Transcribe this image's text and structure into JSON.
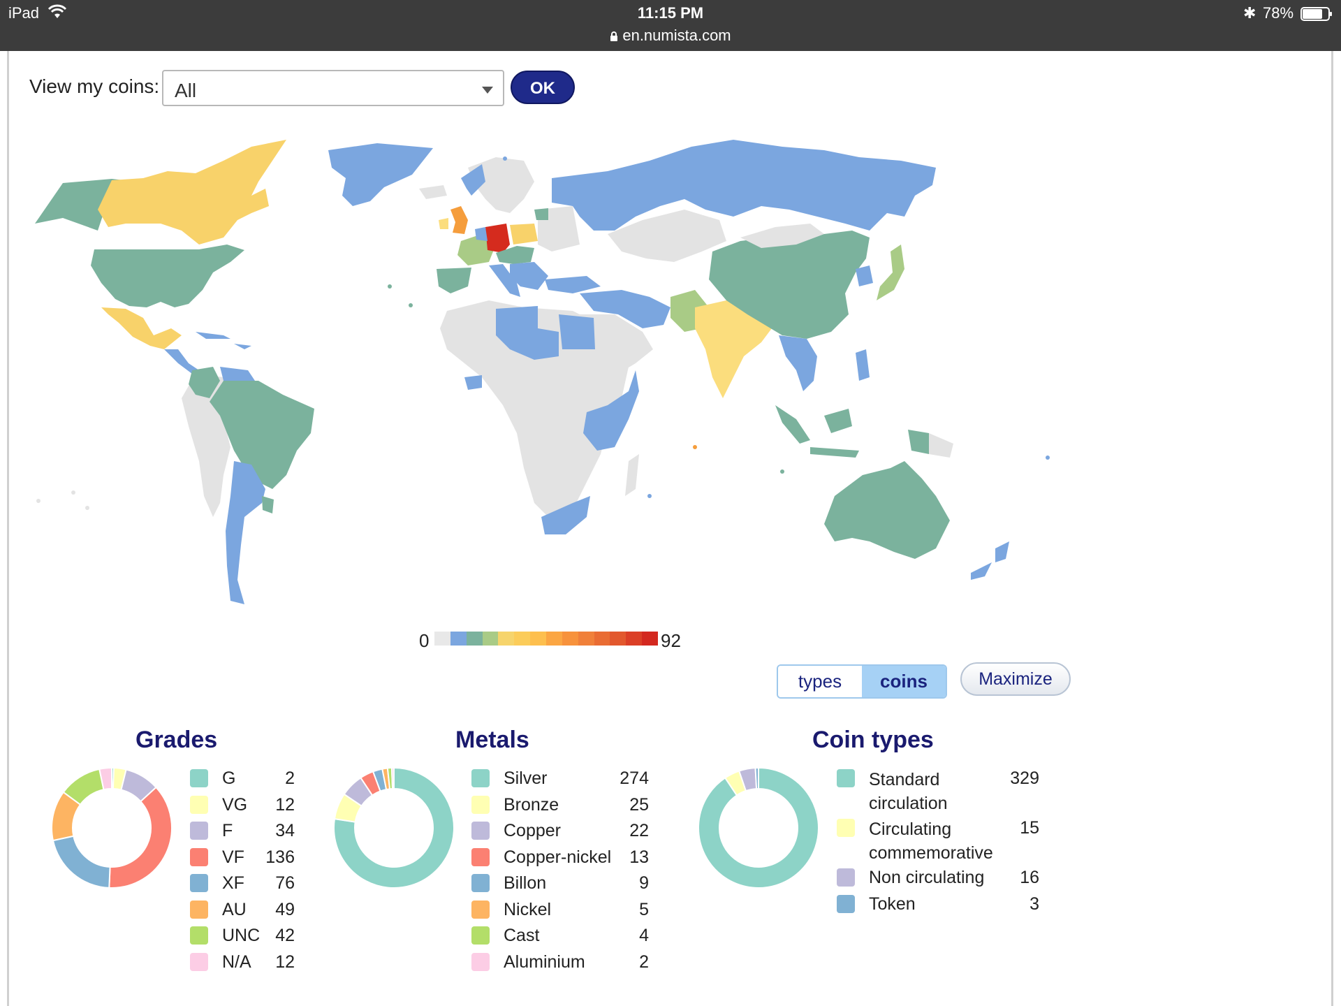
{
  "status_bar": {
    "device": "iPad",
    "time": "11:15 PM",
    "url": "en.numista.com",
    "bluetooth": "✱",
    "battery": "78%",
    "battery_level": 0.78
  },
  "filter": {
    "label": "View my coins:",
    "selected": "All",
    "ok_label": "OK"
  },
  "map": {
    "scale_min": "0",
    "scale_max": "92",
    "scale_colors": [
      "#e8e8e8",
      "#7ba6df",
      "#7bb29d",
      "#a9cb86",
      "#f6d46c",
      "#fbcc5a",
      "#fdbf4e",
      "#fba643",
      "#f7923c",
      "#f0803a",
      "#e96c33",
      "#e2582d",
      "#db3f26",
      "#d3281f"
    ],
    "colors": {
      "none": "#e3e3e3",
      "blue": "#7ba6df",
      "teal": "#7bb29d",
      "lightgreen": "#a9cb86",
      "yellow": "#f8d26a",
      "lightyellow": "#fbdd7d",
      "orange": "#f59d3c",
      "red": "#d52b1e"
    }
  },
  "toggle": {
    "types_label": "types",
    "coins_label": "coins",
    "maximize_label": "Maximize"
  },
  "grades": {
    "title": "Grades",
    "items": [
      {
        "label": "G",
        "value": 2,
        "color": "#8dd3c7"
      },
      {
        "label": "VG",
        "value": 12,
        "color": "#ffffb3"
      },
      {
        "label": "F",
        "value": 34,
        "color": "#bebada"
      },
      {
        "label": "VF",
        "value": 136,
        "color": "#fb8072"
      },
      {
        "label": "XF",
        "value": 76,
        "color": "#80b1d3"
      },
      {
        "label": "AU",
        "value": 49,
        "color": "#fdb462"
      },
      {
        "label": "UNC",
        "value": 42,
        "color": "#b3de69"
      },
      {
        "label": "N/A",
        "value": 12,
        "color": "#fccde5"
      }
    ]
  },
  "metals": {
    "title": "Metals",
    "items": [
      {
        "label": "Silver",
        "value": 274,
        "color": "#8dd3c7"
      },
      {
        "label": "Bronze",
        "value": 25,
        "color": "#ffffb3"
      },
      {
        "label": "Copper",
        "value": 22,
        "color": "#bebada"
      },
      {
        "label": "Copper-nickel",
        "value": 13,
        "color": "#fb8072"
      },
      {
        "label": "Billon",
        "value": 9,
        "color": "#80b1d3"
      },
      {
        "label": "Nickel",
        "value": 5,
        "color": "#fdb462"
      },
      {
        "label": "Cast",
        "value": 4,
        "color": "#b3de69"
      },
      {
        "label": "Aluminium",
        "value": 2,
        "color": "#fccde5"
      }
    ]
  },
  "coin_types": {
    "title": "Coin types",
    "items": [
      {
        "label": "Standard circulation",
        "value": 329,
        "color": "#8dd3c7"
      },
      {
        "label": "Circulating commemorative",
        "value": 15,
        "color": "#ffffb3"
      },
      {
        "label": "Non circulating",
        "value": 16,
        "color": "#bebada"
      },
      {
        "label": "Token",
        "value": 3,
        "color": "#80b1d3"
      }
    ]
  }
}
